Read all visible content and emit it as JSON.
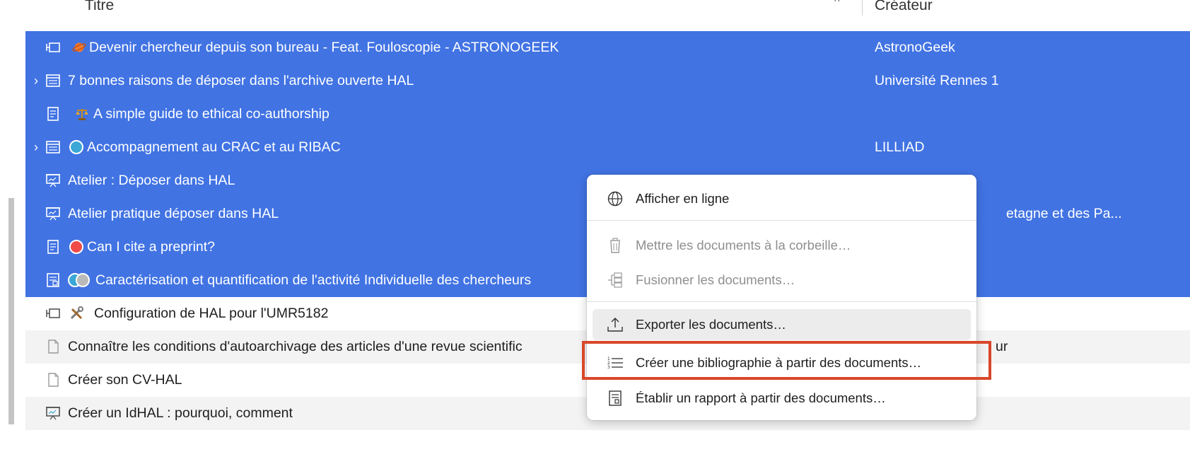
{
  "header": {
    "title_col": "Titre",
    "creator_col": "Créateur",
    "sort_indicator": "^"
  },
  "rows": [
    {
      "title": "Devenir chercheur depuis son bureau - Feat. Fouloscopie - ASTRONOGEEK",
      "creator": "AstronoGeek",
      "twisty": "",
      "icon": "video-icon",
      "emoji": "planet-emoji"
    },
    {
      "title": "7 bonnes raisons de déposer dans l'archive ouverte HAL",
      "creator": "Université Rennes 1",
      "twisty": "›",
      "icon": "webpage-icon",
      "emoji": ""
    },
    {
      "title": "A simple guide to ethical co-authorship",
      "creator": "",
      "twisty": "",
      "icon": "document-icon",
      "emoji": "scales-emoji"
    },
    {
      "title": "Accompagnement au CRAC et au RIBAC",
      "creator": "LILLIAD",
      "twisty": "›",
      "icon": "webpage-icon",
      "emoji": "blue-tag-dot"
    },
    {
      "title": "Atelier : Déposer dans HAL",
      "creator": "",
      "twisty": "",
      "icon": "presentation-icon",
      "emoji": ""
    },
    {
      "title": "Atelier pratique déposer dans HAL",
      "creator": "etagne et des Pa...",
      "twisty": "",
      "icon": "presentation-icon",
      "emoji": ""
    },
    {
      "title": "Can I cite a preprint?",
      "creator": "",
      "twisty": "",
      "icon": "document-icon",
      "emoji": "red-tag-dot"
    },
    {
      "title": "Caractérisation et quantification de l'activité Individuelle des chercheurs",
      "creator": "",
      "twisty": "",
      "icon": "report-icon",
      "emoji": "blue-grey-tag-dots"
    },
    {
      "title": "Configuration de HAL pour l'UMR5182",
      "creator": "",
      "twisty": "",
      "icon": "video-icon",
      "emoji": "tools-emoji"
    },
    {
      "title": "Connaître les conditions d'autoarchivage des articles d'une revue scientific",
      "creator": "ur",
      "twisty": "",
      "icon": "blank-page-icon",
      "emoji": ""
    },
    {
      "title": "Créer son CV-HAL",
      "creator": "",
      "twisty": "",
      "icon": "blank-page-icon",
      "emoji": ""
    },
    {
      "title": "Créer un IdHAL : pourquoi, comment",
      "creator": "",
      "twisty": "",
      "icon": "presentation-icon",
      "emoji": ""
    }
  ],
  "context_menu": {
    "view_online": "Afficher en ligne",
    "trash": "Mettre les documents à la corbeille…",
    "merge": "Fusionner les documents…",
    "export": "Exporter les documents…",
    "create_bibliography": "Créer une bibliographie à partir des documents…",
    "generate_report": "Établir un rapport à partir des documents…"
  },
  "colors": {
    "selection": "#4173e3",
    "highlight_box": "#d9472b",
    "tag_red": "#f04a4a",
    "tag_blue": "#3ba7d6",
    "tag_grey": "#b9b9b9"
  }
}
